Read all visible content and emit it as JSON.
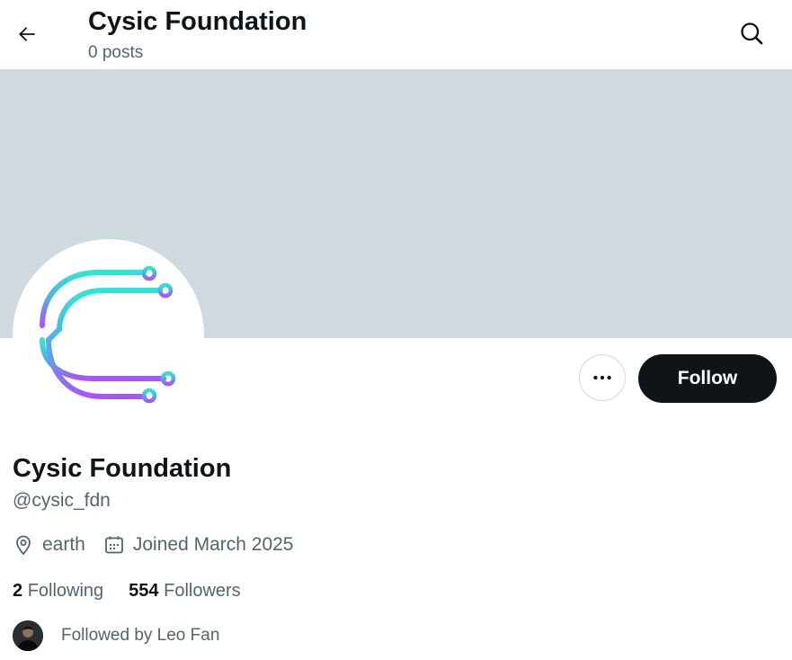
{
  "header": {
    "title": "Cysic Foundation",
    "posts_count": "0 posts"
  },
  "profile": {
    "display_name": "Cysic Foundation",
    "handle": "@cysic_fdn",
    "location": "earth",
    "joined": "Joined March 2025",
    "follow_label": "Follow"
  },
  "stats": {
    "following_count": "2",
    "following_label": "Following",
    "followers_count": "554",
    "followers_label": "Followers"
  },
  "followed_by": {
    "text": "Followed by Leo Fan"
  },
  "colors": {
    "banner": "#cfd9de",
    "follow_button": "#0f1419",
    "secondary_text": "#536471",
    "logo_gradient_start": "#2de6d6",
    "logo_gradient_end": "#a855f7"
  },
  "icons": {
    "back": "arrow-left-icon",
    "search": "search-icon",
    "more": "more-horizontal-icon",
    "location": "location-pin-icon",
    "calendar": "calendar-icon"
  }
}
